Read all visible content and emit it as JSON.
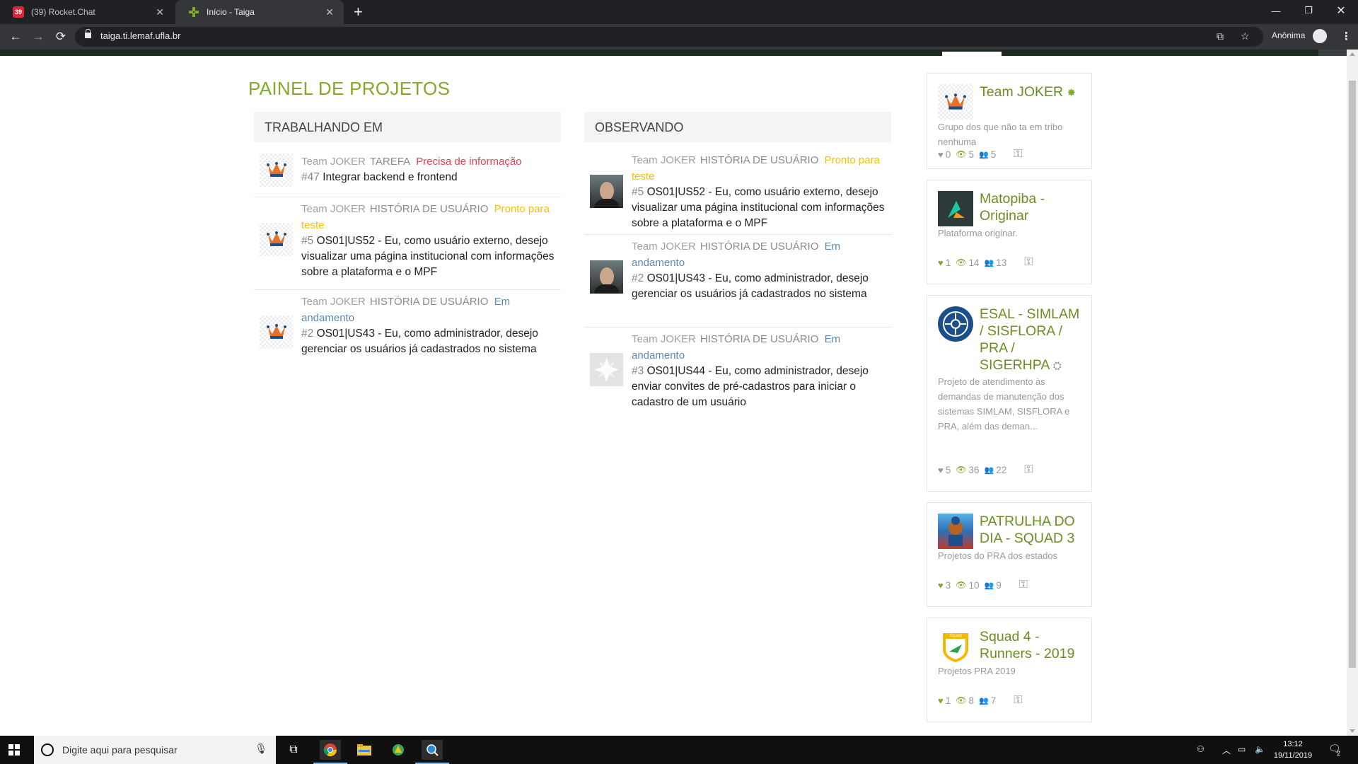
{
  "browser": {
    "tabs": [
      {
        "title": "(39) Rocket.Chat",
        "favicon_text": "39"
      },
      {
        "title": "Início - Taiga"
      }
    ],
    "url": "taiga.ti.lemaf.ufla.br",
    "profile_label": "Anônima"
  },
  "page": {
    "title": "PAINEL DE PROJETOS",
    "working_on": {
      "heading": "TRABALHANDO EM",
      "items": [
        {
          "project": "Team JOKER",
          "type": "TAREFA",
          "status": "Precisa de informação",
          "ref": "#47",
          "text": "Integrar backend e frontend"
        },
        {
          "project": "Team JOKER",
          "type": "HISTÓRIA DE USUÁRIO",
          "status": "Pronto para teste",
          "ref": "#5",
          "text": "OS01|US52 - Eu, como usuário externo, desejo visualizar uma página institucional com informações sobre a plataforma e o MPF"
        },
        {
          "project": "Team JOKER",
          "type": "HISTÓRIA DE USUÁRIO",
          "status": "Em andamento",
          "ref": "#2",
          "text": "OS01|US43 - Eu, como administrador, desejo gerenciar os usuários já cadastrados no sistema"
        }
      ]
    },
    "watching": {
      "heading": "OBSERVANDO",
      "items": [
        {
          "project": "Team JOKER",
          "type": "HISTÓRIA DE USUÁRIO",
          "status": "Pronto para teste",
          "ref": "#5",
          "text": "OS01|US52 - Eu, como usuário externo, desejo visualizar uma página institucional com informações sobre a plataforma e o MPF"
        },
        {
          "project": "Team JOKER",
          "type": "HISTÓRIA DE USUÁRIO",
          "status": "Em andamento",
          "ref": "#2",
          "text": "OS01|US43 - Eu, como administrador, desejo gerenciar os usuários já cadastrados no sistema"
        },
        {
          "project": "Team JOKER",
          "type": "HISTÓRIA DE USUÁRIO",
          "status": "Em andamento",
          "ref": "#3",
          "text": "OS01|US44 - Eu, como administrador, desejo enviar convites de pré-cadastros para iniciar o cadastro de um usuário"
        }
      ]
    }
  },
  "projects": [
    {
      "name": "Team JOKER",
      "description": "Grupo dos que não ta em tribo nenhuma",
      "likes": "0",
      "watchers": "5",
      "members": "5"
    },
    {
      "name": "Matopiba - Originar",
      "description": "Plataforma originar.",
      "likes": "1",
      "watchers": "14",
      "members": "13"
    },
    {
      "name": "ESAL - SIMLAM / SISFLORA / PRA / SIGERHPA",
      "description": "Projeto de atendimento às demandas de manutenção dos sistemas SIMLAM, SISFLORA e PRA, além das deman...",
      "likes": "5",
      "watchers": "36",
      "members": "22"
    },
    {
      "name": "PATRULHA DO DIA - SQUAD 3",
      "description": "Projetos do PRA dos estados",
      "likes": "3",
      "watchers": "10",
      "members": "9"
    },
    {
      "name": "Squad 4 - Runners - 2019",
      "description": "Projetos PRA 2019",
      "logo_text": "Squad",
      "likes": "1",
      "watchers": "8",
      "members": "7"
    }
  ],
  "taskbar": {
    "search_placeholder": "Digite aqui para pesquisar",
    "time": "13:12",
    "date": "19/11/2019",
    "notifications": "2"
  },
  "colors": {
    "brand_green": "#83a92c",
    "status_red": "#e44057",
    "status_yellow": "#fcc000",
    "status_blue": "#5b8ab8"
  }
}
